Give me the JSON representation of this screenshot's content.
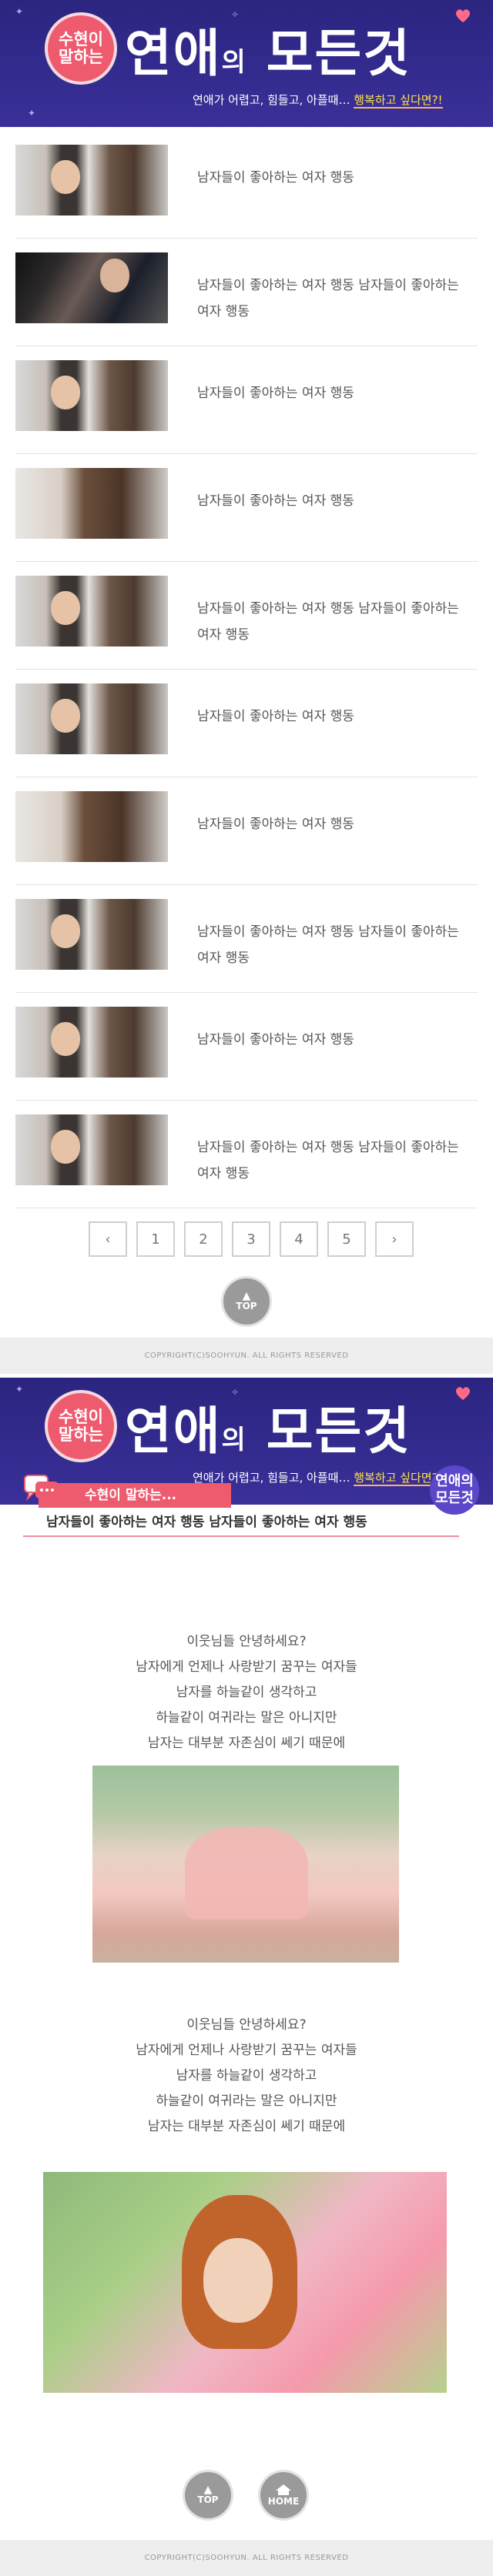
{
  "header": {
    "badge_line1": "수현이",
    "badge_line2": "말하는",
    "brand_main": "연애",
    "brand_small": "의",
    "brand_rest": "모든것",
    "tagline_plain": "연애가 어렵고, 힘들고, 아플때… ",
    "tagline_highlight": "행복하고 싶다면?!"
  },
  "list": {
    "items": [
      {
        "title": "남자들이 좋아하는 여자 행동",
        "thumb": "a"
      },
      {
        "title": "남자들이 좋아하는 여자 행동 남자들이 좋아하는 여자 행동",
        "thumb": "b"
      },
      {
        "title": "남자들이 좋아하는 여자 행동",
        "thumb": "a"
      },
      {
        "title": "남자들이 좋아하는 여자 행동",
        "thumb": "c"
      },
      {
        "title": "남자들이 좋아하는 여자 행동 남자들이 좋아하는 여자 행동",
        "thumb": "a"
      },
      {
        "title": "남자들이 좋아하는 여자 행동",
        "thumb": "a"
      },
      {
        "title": "남자들이 좋아하는 여자 행동",
        "thumb": "c"
      },
      {
        "title": "남자들이 좋아하는 여자 행동 남자들이 좋아하는 여자 행동",
        "thumb": "a"
      },
      {
        "title": "남자들이 좋아하는 여자 행동",
        "thumb": "a"
      },
      {
        "title": "남자들이 좋아하는 여자 행동 남자들이 좋아하는 여자 행동",
        "thumb": "a"
      }
    ]
  },
  "pagination": {
    "prev": "‹",
    "pages": [
      "1",
      "2",
      "3",
      "4",
      "5"
    ],
    "next": "›"
  },
  "buttons": {
    "top": "TOP",
    "home": "HOME"
  },
  "footer": {
    "copyright": "COPYRIGHT(C)SOOHYUN. ALL RIGHTS RESERVED"
  },
  "detail": {
    "say_label": "수현이 말하는...",
    "title": "남자들이 좋아하는 여자 행동 남자들이 좋아하는 여자 행동",
    "circle_line1": "연애의",
    "circle_line2": "모든것",
    "para1": [
      "이웃님들 안녕하세요?",
      "남자에게 언제나 사랑받기 꿈꾸는 여자들",
      "남자를 하늘같이 생각하고",
      "하늘같이 여귀라는 말은 아니지만",
      "남자는 대부분 자존심이 쎄기 때문에"
    ],
    "para2": [
      "이웃님들 안녕하세요?",
      "남자에게 언제나 사랑받기 꿈꾸는 여자들",
      "남자를 하늘같이 생각하고",
      "하늘같이 여귀라는 말은 아니지만",
      "남자는 대부분 자존심이 쎄기 때문에"
    ]
  },
  "colors": {
    "header_bg": "#2f288a",
    "accent_pink": "#ee5a6e",
    "accent_purple": "#5b47c9",
    "highlight_yellow": "#ffe24a"
  }
}
